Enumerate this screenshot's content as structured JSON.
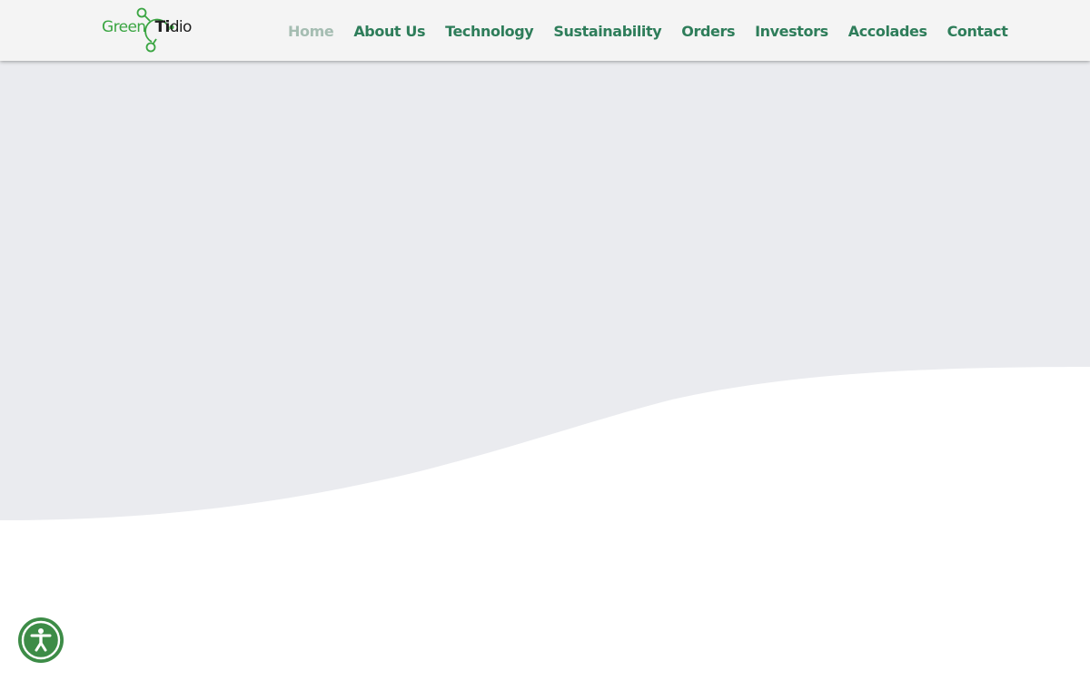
{
  "brand": {
    "logo_part_green": "Green",
    "logo_part_ti": "Ti",
    "logo_part_dio": "dio",
    "colors": {
      "green": "#3aa542",
      "dark": "#1e1e1e"
    }
  },
  "nav": {
    "items": [
      {
        "label": "Home",
        "active": true
      },
      {
        "label": "About Us",
        "active": false
      },
      {
        "label": "Technology",
        "active": false
      },
      {
        "label": "Sustainability",
        "active": false
      },
      {
        "label": "Orders",
        "active": false
      },
      {
        "label": "Investors",
        "active": false
      },
      {
        "label": "Accolades",
        "active": false
      },
      {
        "label": "Contact",
        "active": false
      }
    ],
    "colors": {
      "link": "#2e7d5a",
      "active": "#a5bdb2"
    }
  },
  "hero": {
    "background_color": "#eaebef",
    "wave_color": "#ffffff"
  },
  "accessibility": {
    "icon": "accessibility-person-icon",
    "color": "#3d8c47"
  }
}
